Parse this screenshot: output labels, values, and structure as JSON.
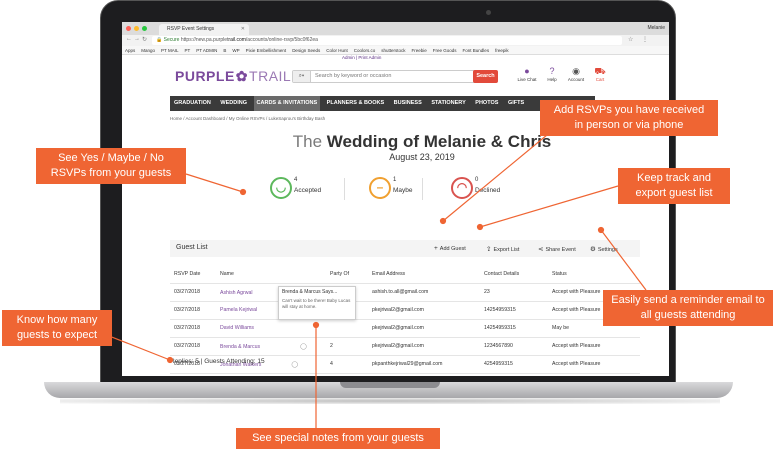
{
  "browser": {
    "tab_title": "RSVP Event Settings",
    "user": "Melanie",
    "url_secure": "Secure",
    "url_prefix": "https://new.pa.purplet",
    "url_domain": "rail.com",
    "url_path": "/accounts/online-rsvp/5bc0f62ea",
    "bookmarks": [
      "Apps",
      "Mango",
      "PT MAIL",
      "PT",
      "PT ADMIN",
      "B",
      "WP",
      "Pixie Embellishment",
      "Design Seeds",
      "Color Hunt",
      "Coolors.co",
      "shutterstock",
      "Freebie",
      "Free Goods",
      "Font Bundles",
      "freepik"
    ]
  },
  "site": {
    "admin_links": "Admin | Print Admin",
    "logo_purple": "PURPLE",
    "logo_trail": "TRAIL",
    "search_placeholder": "Search by keyword or occasion",
    "search_button": "Search",
    "header_icons": [
      {
        "label": "Live Chat",
        "icon": "chat-bubble-icon",
        "glyph": "💬"
      },
      {
        "label": "Help",
        "icon": "question-icon",
        "glyph": "?"
      },
      {
        "label": "Account",
        "icon": "avatar-icon",
        "glyph": "☺"
      },
      {
        "label": "Cart",
        "icon": "cart-icon",
        "glyph": "🛒"
      }
    ],
    "menu": [
      "GRADUATION",
      "WEDDING",
      "CARDS & INVITATIONS",
      "PLANNERS & BOOKS",
      "BUSINESS",
      "STATIONERY",
      "PHOTOS",
      "GIFTS"
    ],
    "breadcrumb": "Home / Account Dashboard / My Online RSVPs / LukeSaprou's Birthday Bash"
  },
  "event": {
    "title_prefix": "The",
    "title_name": "Wedding of Melanie & Chris",
    "date": "August 23, 2019",
    "stats": [
      {
        "count": "4",
        "label": "Accepted",
        "face": "smile-face-icon",
        "glyph": "☺",
        "color": "#5cb85c"
      },
      {
        "count": "1",
        "label": "Maybe",
        "face": "neutral-face-icon",
        "glyph": "😐",
        "color": "#f0a030"
      },
      {
        "count": "0",
        "label": "Declined",
        "face": "sad-face-icon",
        "glyph": "☹",
        "color": "#d9534f"
      }
    ]
  },
  "guest_list": {
    "title": "Guest List",
    "actions": [
      {
        "label": "Add Guest",
        "icon": "plus-icon",
        "glyph": "+"
      },
      {
        "label": "Export List",
        "icon": "export-icon",
        "glyph": "⇪"
      },
      {
        "label": "Share Event",
        "icon": "share-icon",
        "glyph": "⋖"
      },
      {
        "label": "Settings",
        "icon": "gear-icon",
        "glyph": "⚙"
      }
    ],
    "columns": [
      "RSVP Date",
      "Name",
      "Party Of",
      "Email Address",
      "Contact Details",
      "Status"
    ],
    "rows": [
      {
        "date": "03/27/2018",
        "name": "Ashish Agrwal",
        "party": "4",
        "email": "ashish.to.all@gmail.com",
        "contact": "23",
        "status": "Accept with Pleasure"
      },
      {
        "date": "03/27/2018",
        "name": "Pamela Kejriwal",
        "party": "",
        "email": "pkejriwal2@gmail.com",
        "contact": "14254959315",
        "status": "Accept with Pleasure"
      },
      {
        "date": "03/27/2018",
        "name": "David Williams",
        "party": "",
        "email": "pkejriwal2@gmail.com",
        "contact": "14254959315",
        "status": "May be"
      },
      {
        "date": "03/27/2018",
        "name": "Brenda & Marcus",
        "party": "2",
        "email": "pkejriwal2@gmail.com",
        "contact": "1234567890",
        "status": "Accept with Pleasure"
      },
      {
        "date": "03/27/2018",
        "name": "Jonathan Walkers",
        "party": "4",
        "email": "pkpanthkejriwal29@gmail.com",
        "contact": "4254959315",
        "status": "Accept with Pleasure"
      }
    ],
    "note_tooltip": {
      "title": "Brenda & Marcus Says...",
      "message": "Can't wait to be there! Baby Lucas will stay at home."
    },
    "footer_replies": "Replies: 5",
    "footer_attending": "Guests Attending: 15"
  },
  "callouts": {
    "add_rsvps": "Add RSVPs you have received in person or via phone",
    "yes_maybe_no": "See Yes / Maybe / No RSVPs from your guests",
    "keep_track": "Keep track and export guest list",
    "reminder": "Easily send a reminder email to all guests attending",
    "how_many": "Know how many guests to expect",
    "notes": "See special notes from your guests"
  },
  "colors": {
    "brand_purple": "#7b4a9c",
    "callout_orange": "#ef6533",
    "search_red": "#e24a3b"
  }
}
